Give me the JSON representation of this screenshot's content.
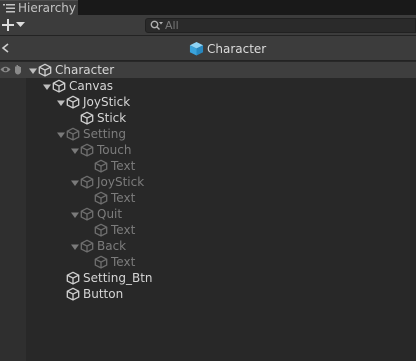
{
  "tab": {
    "label": "Hierarchy"
  },
  "toolbar": {
    "search_placeholder": "All"
  },
  "header": {
    "title": "Character"
  },
  "hierarchy": [
    {
      "label": "Character",
      "depth": 0,
      "expanded": true,
      "active": true
    },
    {
      "label": "Canvas",
      "depth": 1,
      "expanded": true,
      "active": true
    },
    {
      "label": "JoyStick",
      "depth": 2,
      "expanded": true,
      "active": true
    },
    {
      "label": "Stick",
      "depth": 3,
      "expanded": false,
      "active": true
    },
    {
      "label": "Setting",
      "depth": 2,
      "expanded": true,
      "active": false
    },
    {
      "label": "Touch",
      "depth": 3,
      "expanded": true,
      "active": false
    },
    {
      "label": "Text",
      "depth": 4,
      "expanded": false,
      "active": false
    },
    {
      "label": "JoyStick",
      "depth": 3,
      "expanded": true,
      "active": false
    },
    {
      "label": "Text",
      "depth": 4,
      "expanded": false,
      "active": false
    },
    {
      "label": "Quit",
      "depth": 3,
      "expanded": true,
      "active": false
    },
    {
      "label": "Text",
      "depth": 4,
      "expanded": false,
      "active": false
    },
    {
      "label": "Back",
      "depth": 3,
      "expanded": true,
      "active": false
    },
    {
      "label": "Text",
      "depth": 4,
      "expanded": false,
      "active": false
    },
    {
      "label": "Setting_Btn",
      "depth": 2,
      "expanded": false,
      "active": true
    },
    {
      "label": "Button",
      "depth": 2,
      "expanded": false,
      "active": true
    }
  ],
  "colors": {
    "header_cube": "#4fb4e6",
    "cube_active": "#cfcfcf",
    "cube_inactive": "#6e6e6e"
  }
}
